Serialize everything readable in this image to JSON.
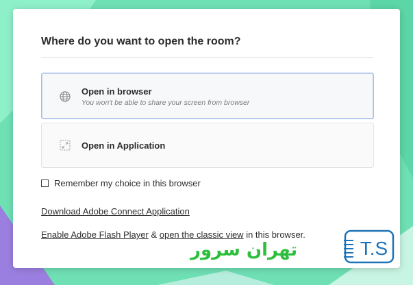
{
  "dialog": {
    "title": "Where do you want to open the room?",
    "options": [
      {
        "label": "Open in browser",
        "sublabel": "You won't be able to share your screen from browser",
        "icon": "globe-icon",
        "selected": true
      },
      {
        "label": "Open in Application",
        "icon": "application-icon",
        "selected": false
      }
    ],
    "remember": {
      "label": "Remember my choice in this browser",
      "checked": false
    },
    "download_link": "Download Adobe Connect Application",
    "flash_line": {
      "flash_link": "Enable Adobe Flash Player",
      "connector": " & ",
      "classic_link": "open the classic view",
      "suffix": " in this browser."
    }
  },
  "watermark": {
    "farsi_text": "تهران سرور",
    "logo_text": "T.S"
  },
  "colors": {
    "background": "#6fe0b4",
    "selected_border": "#a6bde4",
    "watermark_green": "#2dbf3c",
    "watermark_blue": "#1d73b8"
  }
}
